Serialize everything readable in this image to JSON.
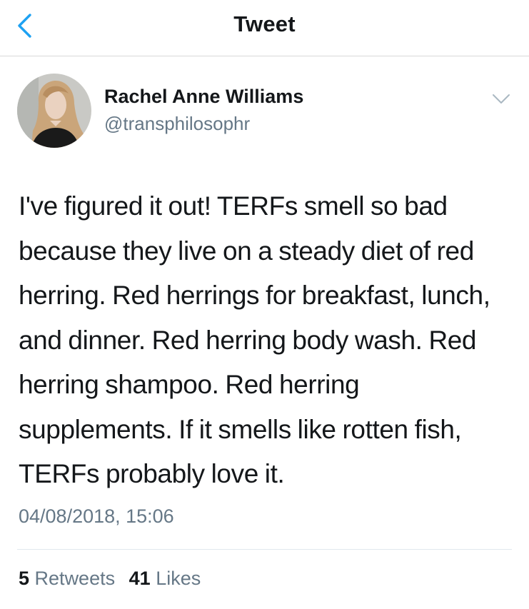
{
  "header": {
    "title": "Tweet"
  },
  "author": {
    "name": "Rachel Anne Williams",
    "handle": "@transphilosophr"
  },
  "tweet": {
    "text": "I've figured it out! TERFs smell so bad because they live on a steady diet of red herring. Red herrings for breakfast, lunch, and dinner. Red herring body wash. Red herring shampoo. Red herring supplements. If it smells like rotten fish, TERFs probably love it.",
    "timestamp": "04/08/2018, 15:06"
  },
  "stats": {
    "retweets_count": "5",
    "retweets_label": "Retweets",
    "likes_count": "41",
    "likes_label": "Likes"
  },
  "icons": {
    "back": "chevron-left-icon",
    "more": "chevron-down-icon"
  },
  "colors": {
    "accent": "#1da1f2",
    "text": "#14171a",
    "secondary_text": "#657786",
    "divider": "#e1e8ed"
  }
}
